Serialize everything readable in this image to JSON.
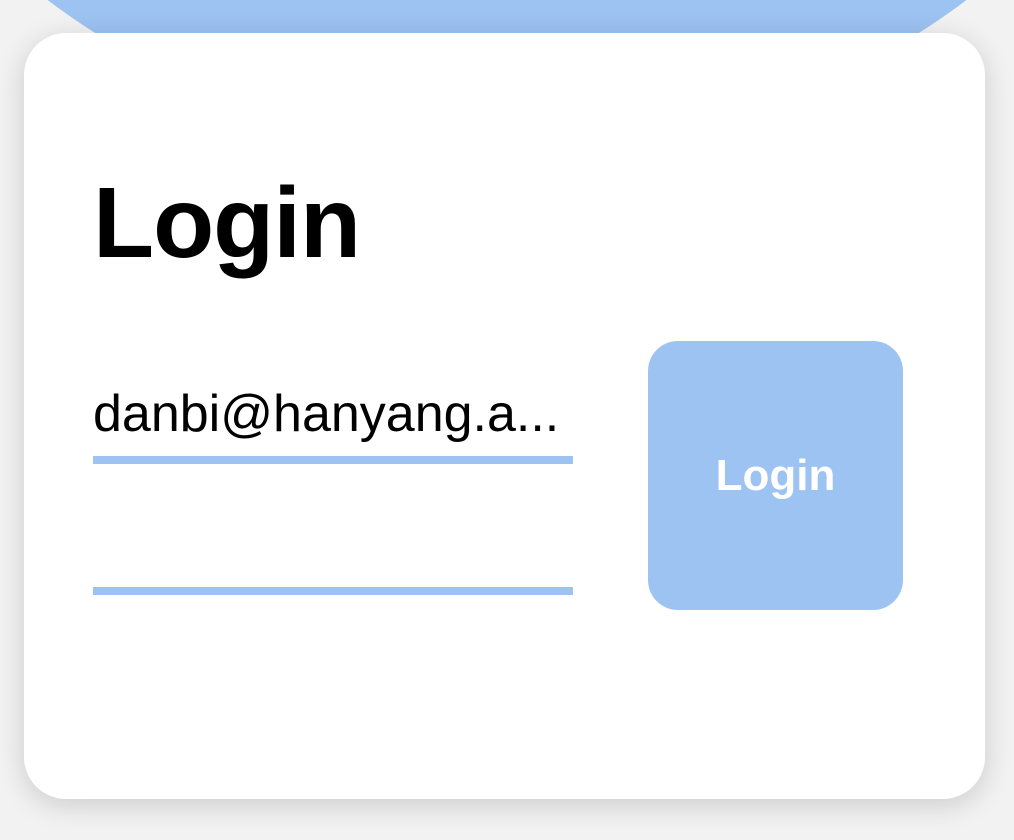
{
  "colors": {
    "accent": "#9dc3f2",
    "card_background": "#ffffff",
    "text": "#000000",
    "button_text": "#ffffff"
  },
  "login_card": {
    "title": "Login",
    "email_field": {
      "value": "danbi@hanyang.a..."
    },
    "password_field": {
      "value": ""
    },
    "login_button_label": "Login"
  }
}
